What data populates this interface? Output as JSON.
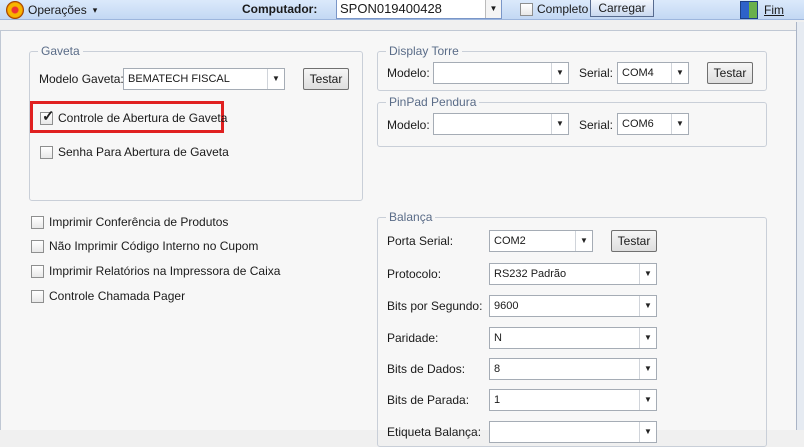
{
  "toolbar": {
    "operations_label": "Operações",
    "operations_caret": "▾",
    "computer_label": "Computador:",
    "computer_value": "SPON019400428",
    "completo_label": "Completo",
    "carregar_label": "Carregar",
    "fim_label": "Fim"
  },
  "gaveta": {
    "title": "Gaveta",
    "modelo_label": "Modelo Gaveta:",
    "modelo_value": "BEMATECH FISCAL",
    "testar_label": "Testar",
    "controle_abertura_label": "Controle de Abertura de Gaveta",
    "controle_abertura_checked": true,
    "senha_abertura_label": "Senha Para Abertura de Gaveta",
    "senha_abertura_checked": false
  },
  "options": [
    {
      "label": "Imprimir Conferência de Produtos",
      "checked": false
    },
    {
      "label": "Não Imprimir Código Interno no Cupom",
      "checked": false
    },
    {
      "label": "Imprimir Relatórios na Impressora de Caixa",
      "checked": false
    },
    {
      "label": "Controle Chamada Pager",
      "checked": false
    }
  ],
  "display_torre": {
    "title": "Display Torre",
    "modelo_label": "Modelo:",
    "modelo_value": "",
    "serial_label": "Serial:",
    "serial_value": "COM4",
    "testar_label": "Testar"
  },
  "pinpad": {
    "title": "PinPad Pendura",
    "modelo_label": "Modelo:",
    "modelo_value": "",
    "serial_label": "Serial:",
    "serial_value": "COM6"
  },
  "balanca": {
    "title": "Balança",
    "porta_label": "Porta Serial:",
    "porta_value": "COM2",
    "testar_label": "Testar",
    "protocolo_label": "Protocolo:",
    "protocolo_value": "RS232 Padrão",
    "bits_segundo_label": "Bits por Segundo:",
    "bits_segundo_value": "9600",
    "paridade_label": "Paridade:",
    "paridade_value": "N",
    "bits_dados_label": "Bits de Dados:",
    "bits_dados_value": "8",
    "bits_parada_label": "Bits de Parada:",
    "bits_parada_value": "1",
    "etiqueta_label": "Etiqueta Balança:"
  },
  "icons": {
    "dropdown_arrow": "▼",
    "check_mark": "✓"
  },
  "colors": {
    "highlight_box": "#e02020",
    "group_title": "#5a6c88"
  }
}
